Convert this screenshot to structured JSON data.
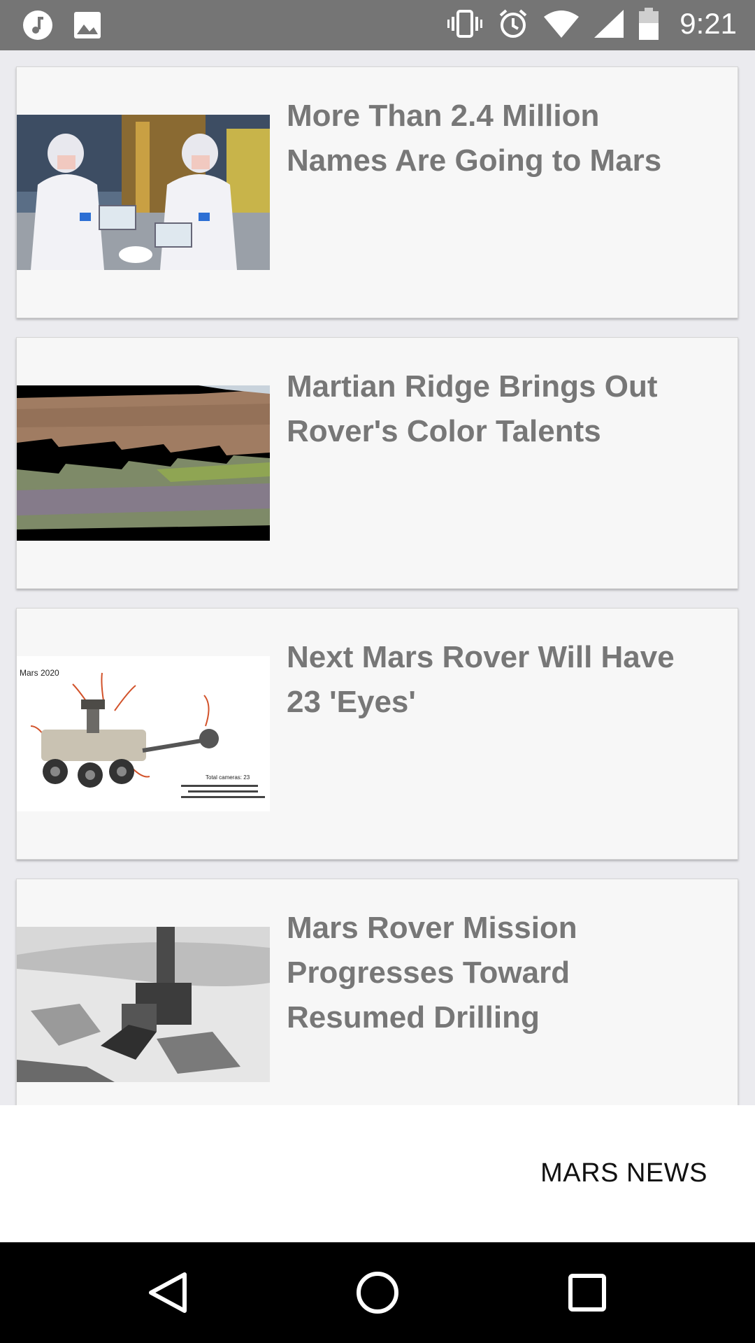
{
  "status_bar": {
    "time": "9:21",
    "left_icons": [
      "music-note-icon",
      "image-icon"
    ],
    "right_icons": [
      "vibrate-icon",
      "alarm-icon",
      "wifi-icon",
      "signal-icon",
      "battery-icon"
    ]
  },
  "articles": [
    {
      "title": "More Than 2.4 Million Names Are Going to Mars"
    },
    {
      "title": "Martian Ridge Brings Out Rover's Color Talents"
    },
    {
      "title": "Next Mars Rover Will Have 23 'Eyes'"
    },
    {
      "title": "Mars Rover Mission Progresses Toward Resumed Drilling"
    }
  ],
  "thumb_text": {
    "rover_label": "Mars 2020",
    "total_cameras": "Total cameras: 23"
  },
  "bottom_bar": {
    "label": "MARS NEWS"
  },
  "nav": {
    "back": "back-icon",
    "home": "home-icon",
    "recents": "recents-icon"
  },
  "colors": {
    "status_bar": "#757575",
    "card_bg": "#f7f7f7",
    "title_text": "#777777",
    "page_bg": "#ebebef",
    "nav_bar": "#000000"
  }
}
